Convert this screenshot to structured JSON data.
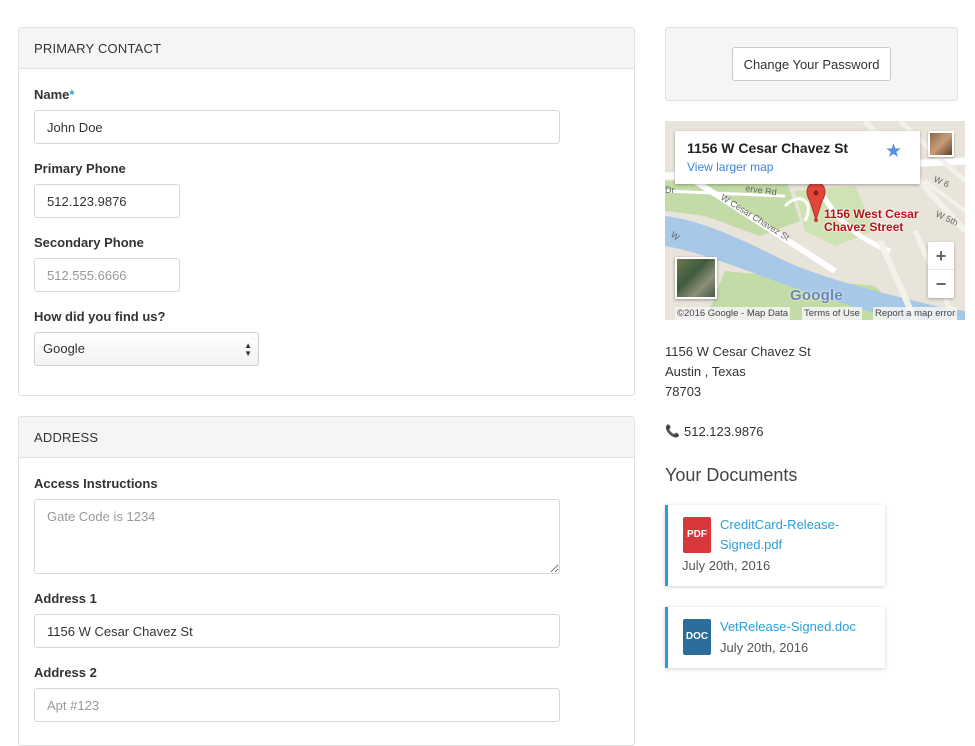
{
  "primary_contact": {
    "heading": "PRIMARY CONTACT",
    "name_label": "Name",
    "name_required": "*",
    "name_value": "John Doe",
    "primary_phone_label": "Primary Phone",
    "primary_phone_value": "512.123.9876",
    "secondary_phone_label": "Secondary Phone",
    "secondary_phone_placeholder": "512.555.6666",
    "find_us_label": "How did you find us?",
    "find_us_selected": "Google"
  },
  "address": {
    "heading": "ADDRESS",
    "access_label": "Access Instructions",
    "access_placeholder": "Gate Code is 1234",
    "address1_label": "Address 1",
    "address1_value": "1156 W Cesar Chavez St",
    "address2_label": "Address 2",
    "address2_placeholder": "Apt #123"
  },
  "account": {
    "change_password_label": "Change Your Password"
  },
  "map": {
    "card_title": "1156 W Cesar Chavez St",
    "view_larger": "View larger map",
    "pin_label": "1156 West Cesar Chavez Street",
    "logo": "Google",
    "copyright": "©2016 Google - Map Data",
    "terms": "Terms of Use",
    "report": "Report a map error",
    "zoom_in": "+",
    "zoom_out": "−",
    "street_labels": [
      "W Cesar Chavez St",
      "W Cesar Chavez St",
      "Riverside Rd",
      "W 5th",
      "W 6"
    ]
  },
  "location": {
    "street": "1156 W Cesar Chavez St",
    "city_state": "Austin , Texas",
    "zip": "78703",
    "phone": "512.123.9876"
  },
  "documents": {
    "heading": "Your Documents",
    "items": [
      {
        "name": "CreditCard-Release-Signed.pdf",
        "name_line1": "CreditCard-Release-",
        "name_line2": "Signed.pdf",
        "date": "July 20th, 2016",
        "type": "PDF",
        "icon_color": "#d9383a"
      },
      {
        "name": "VetRelease-Signed.doc",
        "date": "July 20th, 2016",
        "type": "DOC",
        "icon_color": "#2b6e9e"
      }
    ]
  },
  "colors": {
    "accent": "#2a9fd6",
    "map_pin": "#e2463b"
  }
}
